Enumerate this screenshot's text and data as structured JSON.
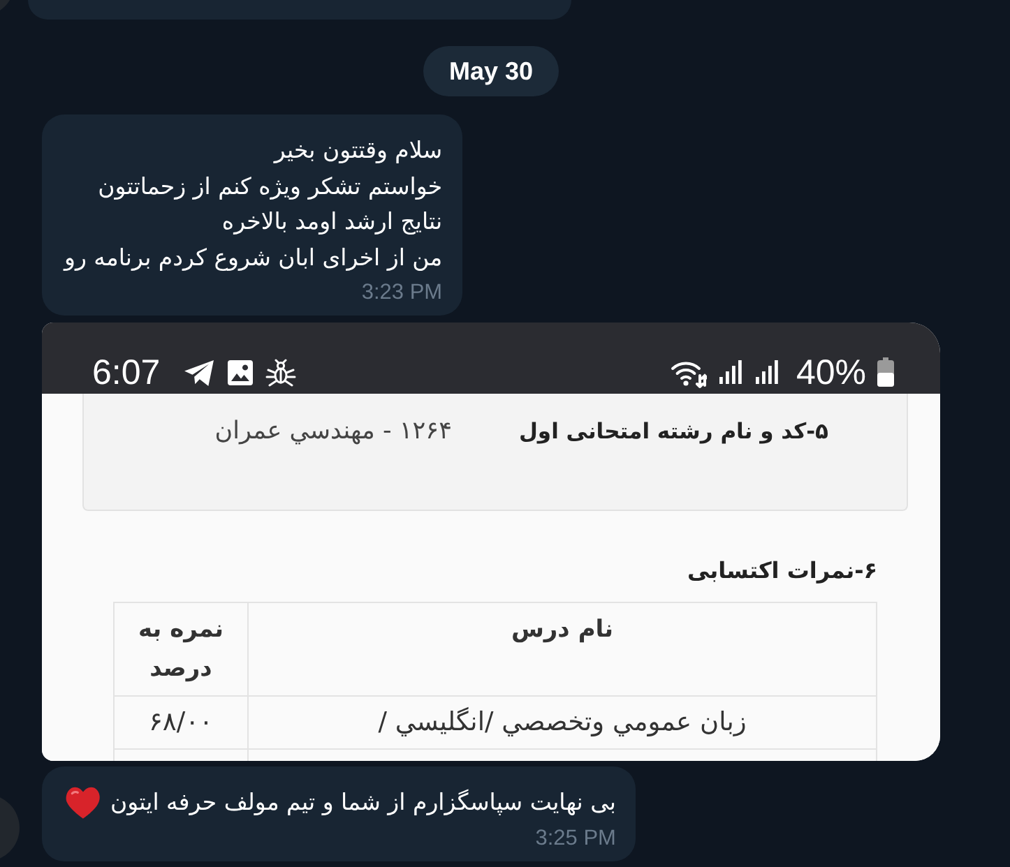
{
  "messages": [
    {
      "kind": "cut_off",
      "avatar": true
    },
    {
      "kind": "date",
      "text": "May 30"
    },
    {
      "kind": "text",
      "avatar": false,
      "text": "سلام وقتتون بخیر\nخواستم تشکر ویژه کنم از زحماتتون\nنتایج ارشد اومد بالاخره\nمن از اخرای ابان شروع کردم برنامه رو",
      "emoji": false,
      "time": "3:23 PM"
    },
    {
      "kind": "screenshot",
      "avatar": false,
      "screenshot": {
        "status_bar": {
          "time": "6:07",
          "battery": "40%"
        },
        "exam_field": {
          "label": "۵-کد و نام رشته امتحانی اول",
          "value": "۱۲۶۴ - مهندسي عمران"
        },
        "section_title": "۶-نمرات اکتسابی",
        "table": {
          "columns": [
            "نام درس",
            "نمره به درصد"
          ],
          "rows": [
            [
              "زبان عمومي وتخصصي /انگليسي /",
              "۶۸/۰۰"
            ]
          ]
        }
      }
    },
    {
      "kind": "text",
      "avatar": true,
      "text": "بی نهایت سپاسگزارم از شما و تیم مولف حرفه ایتون",
      "emoji": true,
      "time": "3:25 PM"
    }
  ]
}
